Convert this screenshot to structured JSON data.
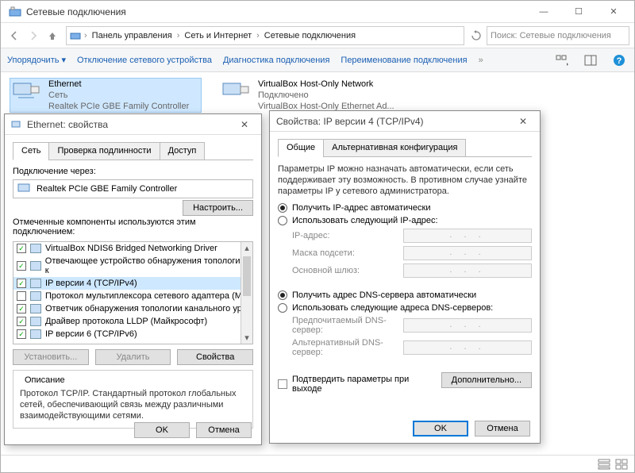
{
  "window": {
    "title": "Сетевые подключения",
    "breadcrumbs": [
      "Панель управления",
      "Сеть и Интернет",
      "Сетевые подключения"
    ],
    "search_placeholder": "Поиск: Сетевые подключения"
  },
  "cmdbar": {
    "organize": "Упорядочить",
    "disable": "Отключение сетевого устройства",
    "diagnose": "Диагностика подключения",
    "rename": "Переименование подключения"
  },
  "adapters": [
    {
      "name": "Ethernet",
      "status": "Сеть",
      "desc": "Realtek PCIe GBE Family Controller",
      "selected": true
    },
    {
      "name": "VirtualBox Host-Only Network",
      "status": "Подключено",
      "desc": "VirtualBox Host-Only Ethernet Ad...",
      "selected": false
    }
  ],
  "ethProps": {
    "title": "Ethernet: свойства",
    "tabs": [
      "Сеть",
      "Проверка подлинности",
      "Доступ"
    ],
    "activeTab": 0,
    "connectUsing": "Подключение через:",
    "adapter": "Realtek PCIe GBE Family Controller",
    "configure": "Настроить...",
    "componentsLabel": "Отмеченные компоненты используются этим подключением:",
    "components": [
      {
        "checked": true,
        "name": "VirtualBox NDIS6 Bridged Networking Driver"
      },
      {
        "checked": true,
        "name": "Отвечающее устройство обнаружения топологии к"
      },
      {
        "checked": true,
        "name": "IP версии 4 (TCP/IPv4)",
        "selected": true
      },
      {
        "checked": false,
        "name": "Протокол мультиплексора сетевого адаптера (Ма"
      },
      {
        "checked": true,
        "name": "Ответчик обнаружения топологии канального уро"
      },
      {
        "checked": true,
        "name": "Драйвер протокола LLDP (Майкрософт)"
      },
      {
        "checked": true,
        "name": "IP версии 6 (TCP/IPv6)"
      }
    ],
    "install": "Установить...",
    "uninstall": "Удалить",
    "properties": "Свойства",
    "descTitle": "Описание",
    "desc": "Протокол TCP/IP. Стандартный протокол глобальных сетей, обеспечивающий связь между различными взаимодействующими сетями.",
    "ok": "OK",
    "cancel": "Отмена"
  },
  "ipv4": {
    "title": "Свойства: IP версии 4 (TCP/IPv4)",
    "tabs": [
      "Общие",
      "Альтернативная конфигурация"
    ],
    "intro": "Параметры IP можно назначать автоматически, если сеть поддерживает эту возможность. В противном случае узнайте параметры IP у сетевого администратора.",
    "r1": "Получить IP-адрес автоматически",
    "r2": "Использовать следующий IP-адрес:",
    "ip": "IP-адрес:",
    "mask": "Маска подсети:",
    "gw": "Основной шлюз:",
    "r3": "Получить адрес DNS-сервера автоматически",
    "r4": "Использовать следующие адреса DNS-серверов:",
    "dns1": "Предпочитаемый DNS-сервер:",
    "dns2": "Альтернативный DNS-сервер:",
    "confirm": "Подтвердить параметры при выходе",
    "advanced": "Дополнительно...",
    "ok": "OK",
    "cancel": "Отмена"
  }
}
